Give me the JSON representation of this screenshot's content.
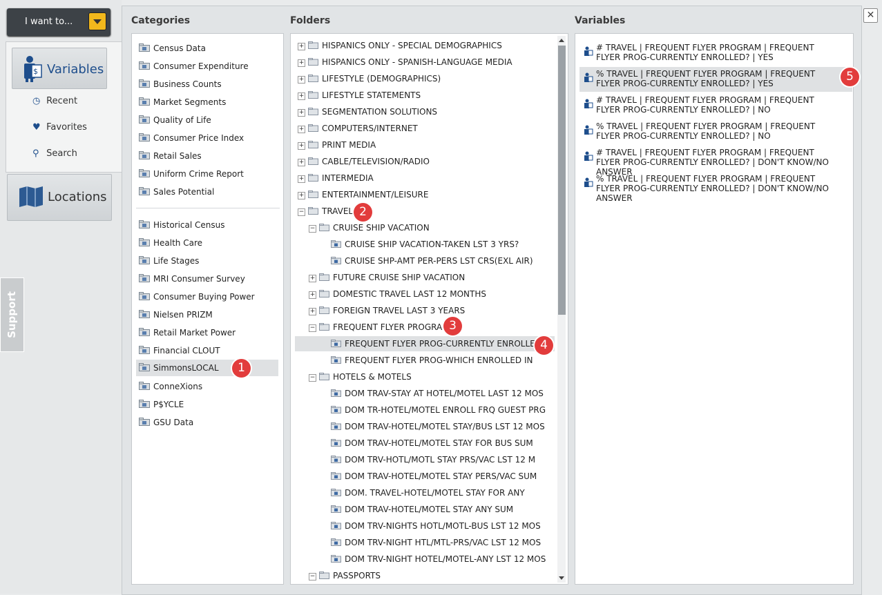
{
  "header": {
    "i_want_label": "I want to..."
  },
  "nav": {
    "variables": "Variables",
    "recent": "Recent",
    "favorites": "Favorites",
    "search": "Search",
    "locations": "Locations"
  },
  "support_label": "Support",
  "close_label": "✕",
  "columns": {
    "categories": "Categories",
    "folders": "Folders",
    "variables": "Variables"
  },
  "categories_top": [
    "Census Data",
    "Consumer Expenditure",
    "Business Counts",
    "Market Segments",
    "Quality of Life",
    "Consumer Price Index",
    "Retail Sales",
    "Uniform Crime Report",
    "Sales Potential"
  ],
  "categories_bottom": [
    "Historical Census",
    "Health Care",
    "Life Stages",
    "MRI Consumer Survey",
    "Consumer Buying Power",
    "Nielsen PRIZM",
    "Retail Market Power",
    "Financial CLOUT",
    "SimmonsLOCAL",
    "ConneXions",
    "P$YCLE",
    "GSU Data"
  ],
  "folders": [
    {
      "label": "HISPANICS ONLY - SPECIAL DEMOGRAPHICS",
      "level": 0,
      "type": "folder",
      "exp": "+"
    },
    {
      "label": "HISPANICS ONLY - SPANISH-LANGUAGE MEDIA",
      "level": 0,
      "type": "folder",
      "exp": "+"
    },
    {
      "label": "LIFESTYLE (DEMOGRAPHICS)",
      "level": 0,
      "type": "folder",
      "exp": "+"
    },
    {
      "label": "LIFESTYLE STATEMENTS",
      "level": 0,
      "type": "folder",
      "exp": "+"
    },
    {
      "label": "SEGMENTATION SOLUTIONS",
      "level": 0,
      "type": "folder",
      "exp": "+"
    },
    {
      "label": "COMPUTERS/INTERNET",
      "level": 0,
      "type": "folder",
      "exp": "+"
    },
    {
      "label": "PRINT MEDIA",
      "level": 0,
      "type": "folder",
      "exp": "+"
    },
    {
      "label": "CABLE/TELEVISION/RADIO",
      "level": 0,
      "type": "folder",
      "exp": "+"
    },
    {
      "label": "INTERMEDIA",
      "level": 0,
      "type": "folder",
      "exp": "+"
    },
    {
      "label": "ENTERTAINMENT/LEISURE",
      "level": 0,
      "type": "folder",
      "exp": "+"
    },
    {
      "label": "TRAVEL",
      "level": 0,
      "type": "open",
      "exp": "−"
    },
    {
      "label": "CRUISE SHIP VACATION",
      "level": 1,
      "type": "open",
      "exp": "−"
    },
    {
      "label": "CRUISE SHIP VACATION-TAKEN LST 3 YRS?",
      "level": 2,
      "type": "item",
      "exp": ""
    },
    {
      "label": "CRUISE SHP-AMT PER-PERS LST CRS(EXL AIR)",
      "level": 2,
      "type": "item",
      "exp": ""
    },
    {
      "label": "FUTURE CRUISE SHIP VACATION",
      "level": 1,
      "type": "folder",
      "exp": "+"
    },
    {
      "label": "DOMESTIC TRAVEL LAST 12 MONTHS",
      "level": 1,
      "type": "folder",
      "exp": "+"
    },
    {
      "label": "FOREIGN TRAVEL LAST 3 YEARS",
      "level": 1,
      "type": "folder",
      "exp": "+"
    },
    {
      "label": "FREQUENT FLYER PROGRAM",
      "level": 1,
      "type": "open",
      "exp": "−"
    },
    {
      "label": "FREQUENT FLYER PROG-CURRENTLY ENROLLED?",
      "level": 2,
      "type": "item",
      "exp": ""
    },
    {
      "label": "FREQUENT FLYER PROG-WHICH ENROLLED IN",
      "level": 2,
      "type": "item",
      "exp": ""
    },
    {
      "label": "HOTELS & MOTELS",
      "level": 1,
      "type": "open",
      "exp": "−"
    },
    {
      "label": "DOM TRAV-STAY AT HOTEL/MOTEL LAST 12 MOS",
      "level": 2,
      "type": "item",
      "exp": ""
    },
    {
      "label": "DOM TR-HOTEL/MOTEL ENROLL FRQ GUEST PRG",
      "level": 2,
      "type": "item",
      "exp": ""
    },
    {
      "label": "DOM TRAV-HOTEL/MOTEL STAY/BUS LST 12 MOS",
      "level": 2,
      "type": "item",
      "exp": ""
    },
    {
      "label": "DOM TRAV-HOTEL/MOTEL STAY FOR BUS SUM",
      "level": 2,
      "type": "item",
      "exp": ""
    },
    {
      "label": "DOM TRV-HOTL/MOTL STAY PRS/VAC LST 12 M",
      "level": 2,
      "type": "item",
      "exp": ""
    },
    {
      "label": "DOM TRAV-HOTEL/MOTEL STAY PERS/VAC SUM",
      "level": 2,
      "type": "item",
      "exp": ""
    },
    {
      "label": "DOM. TRAVEL-HOTEL/MOTEL STAY FOR ANY",
      "level": 2,
      "type": "item",
      "exp": ""
    },
    {
      "label": "DOM TRAV-HOTEL/MOTEL STAY ANY SUM",
      "level": 2,
      "type": "item",
      "exp": ""
    },
    {
      "label": "DOM TRV-NIGHTS HOTL/MOTL-BUS LST 12 MOS",
      "level": 2,
      "type": "item",
      "exp": ""
    },
    {
      "label": "DOM TRV-NIGHT HTL/MTL-PRS/VAC LST 12 MOS",
      "level": 2,
      "type": "item",
      "exp": ""
    },
    {
      "label": "DOM TRV-NIGHT HOTEL/MOTEL-ANY LST 12 MOS",
      "level": 2,
      "type": "item",
      "exp": ""
    },
    {
      "label": "PASSPORTS",
      "level": 1,
      "type": "open",
      "exp": "−"
    }
  ],
  "variables": [
    "# TRAVEL | FREQUENT FLYER PROGRAM | FREQUENT FLYER PROG-CURRENTLY ENROLLED? | YES",
    "% TRAVEL | FREQUENT FLYER PROGRAM | FREQUENT FLYER PROG-CURRENTLY ENROLLED? | YES",
    "# TRAVEL | FREQUENT FLYER PROGRAM | FREQUENT FLYER PROG-CURRENTLY ENROLLED? | NO",
    "% TRAVEL | FREQUENT FLYER PROGRAM | FREQUENT FLYER PROG-CURRENTLY ENROLLED? | NO",
    "# TRAVEL | FREQUENT FLYER PROGRAM | FREQUENT FLYER PROG-CURRENTLY ENROLLED? | DON'T KNOW/NO ANSWER",
    "% TRAVEL | FREQUENT FLYER PROGRAM | FREQUENT FLYER PROG-CURRENTLY ENROLLED? | DON'T KNOW/NO ANSWER"
  ],
  "badges": [
    "1",
    "2",
    "3",
    "4",
    "5"
  ],
  "colors": {
    "accent": "#1e4e8c",
    "badge": "#e23c3c",
    "button": "#f2b81c"
  }
}
